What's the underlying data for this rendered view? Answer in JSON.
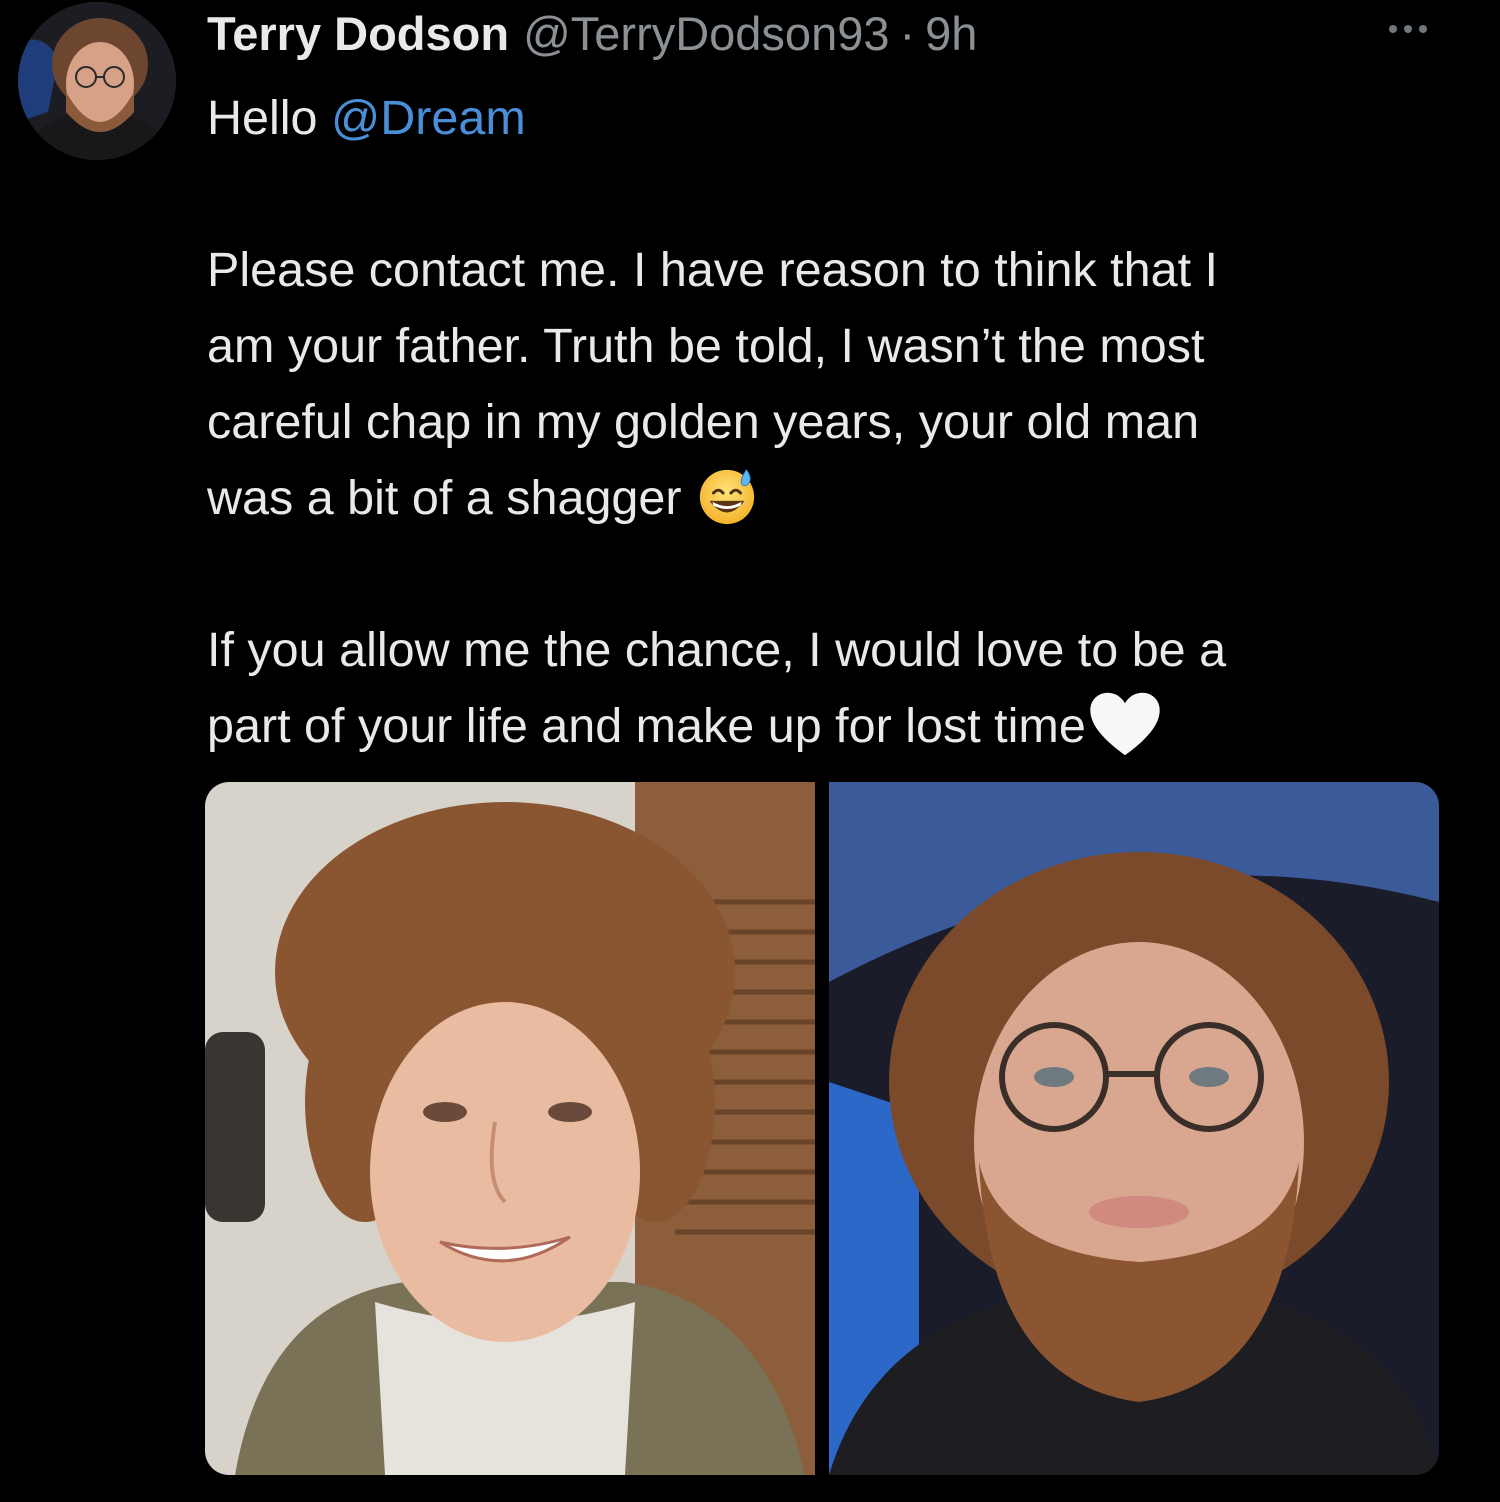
{
  "tweet": {
    "display_name": "Terry Dodson",
    "handle": "@TerryDodson93",
    "separator": "·",
    "time": "9h",
    "text": {
      "line1_prefix": "Hello ",
      "line1_mention": "@Dream",
      "para1": [
        "Please contact me. I have reason to think that I",
        "am your father. Truth be told, I wasn’t the most",
        "careful chap in my golden years, your old man",
        "was a bit of a shagger"
      ],
      "para2": [
        "If you allow me the chance, I would love to be a",
        "part of your life and make up for lost time"
      ]
    },
    "emojis": {
      "after_para1": "grinning-face-with-sweat-emoji",
      "after_para2": "white-heart-emoji"
    },
    "media": {
      "count": 2
    }
  },
  "colors": {
    "background": "#000000",
    "text": "#e7e9ea",
    "secondary": "#8b9095",
    "link": "#4b8ed8"
  },
  "icons": {
    "more": "more-horizontal-icon"
  }
}
